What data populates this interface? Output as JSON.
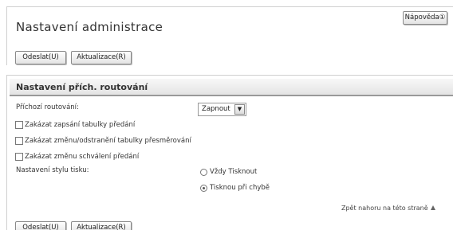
{
  "header": {
    "title": "Nastavení administrace",
    "help_label": "Nápověda①"
  },
  "toolbar": {
    "send_label": "Odeslat(U)",
    "update_label": "Aktualizace(R)"
  },
  "section": {
    "title": "Nastavení přích. routování",
    "incoming_routing": {
      "label": "Příchozí routování:",
      "selected": "Zapnout",
      "arrow_icon": "chevron-down-icon"
    },
    "checkboxes": [
      {
        "label": "Zakázat zapsání tabulky předání",
        "checked": false
      },
      {
        "label": "Zakázat změnu/odstranění tabulky přesměrování",
        "checked": false
      },
      {
        "label": "Zakázat změnu schválení předání",
        "checked": false
      }
    ],
    "print_style": {
      "label": "Nastavení stylu tisku:",
      "options": [
        {
          "label": "Vždy Tisknout",
          "checked": false
        },
        {
          "label": "Tisknou při chybě",
          "checked": true
        }
      ]
    }
  },
  "footer": {
    "back_to_top": "Zpět nahoru na této straně"
  }
}
